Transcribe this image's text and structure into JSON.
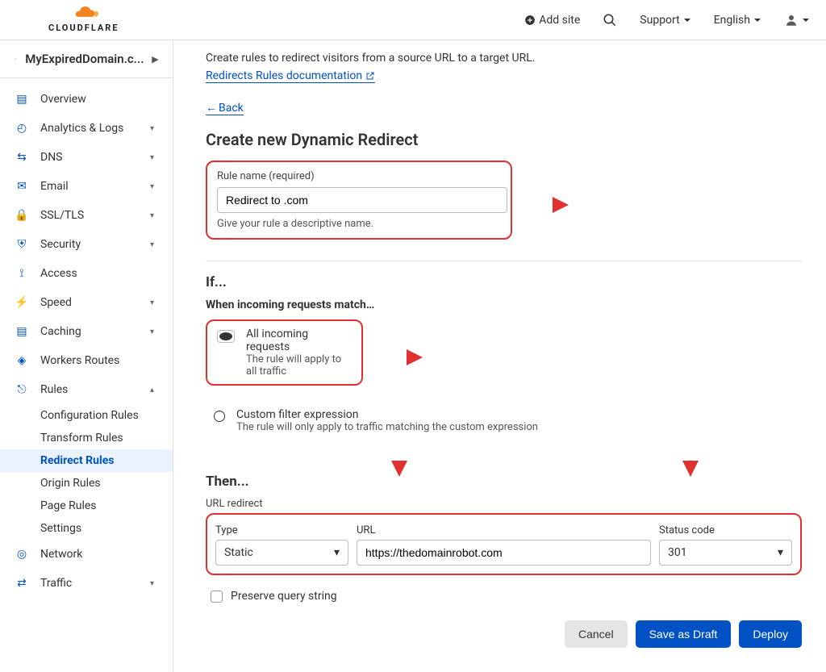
{
  "header": {
    "add_site": "Add site",
    "support": "Support",
    "language": "English"
  },
  "domain": "MyExpiredDomain.c...",
  "sidebar": {
    "overview": "Overview",
    "analytics": "Analytics & Logs",
    "dns": "DNS",
    "email": "Email",
    "ssl": "SSL/TLS",
    "security": "Security",
    "access": "Access",
    "speed": "Speed",
    "caching": "Caching",
    "workers": "Workers Routes",
    "rules": "Rules",
    "rules_sub": {
      "config": "Configuration Rules",
      "transform": "Transform Rules",
      "redirect": "Redirect Rules",
      "origin": "Origin Rules",
      "page": "Page Rules",
      "settings": "Settings"
    },
    "network": "Network",
    "traffic": "Traffic"
  },
  "intro_text": "Create rules to redirect visitors from a source URL to a target URL.",
  "doc_link": "Redirects Rules documentation",
  "back": "Back",
  "h2": "Create new Dynamic Redirect",
  "rule_name": {
    "label": "Rule name (required)",
    "value": "Redirect to .com",
    "hint": "Give your rule a descriptive name."
  },
  "if": {
    "heading": "If...",
    "subhead": "When incoming requests match…",
    "opt_all_title": "All incoming requests",
    "opt_all_sub": "The rule will apply to all traffic",
    "opt_custom_title": "Custom filter expression",
    "opt_custom_sub": "The rule will only apply to traffic matching the custom expression"
  },
  "then": {
    "heading": "Then...",
    "subhead": "URL redirect",
    "type_label": "Type",
    "type_value": "Static",
    "url_label": "URL",
    "url_value": "https://thedomainrobot.com",
    "status_label": "Status code",
    "status_value": "301",
    "preserve": "Preserve query string"
  },
  "buttons": {
    "cancel": "Cancel",
    "draft": "Save as Draft",
    "deploy": "Deploy"
  }
}
